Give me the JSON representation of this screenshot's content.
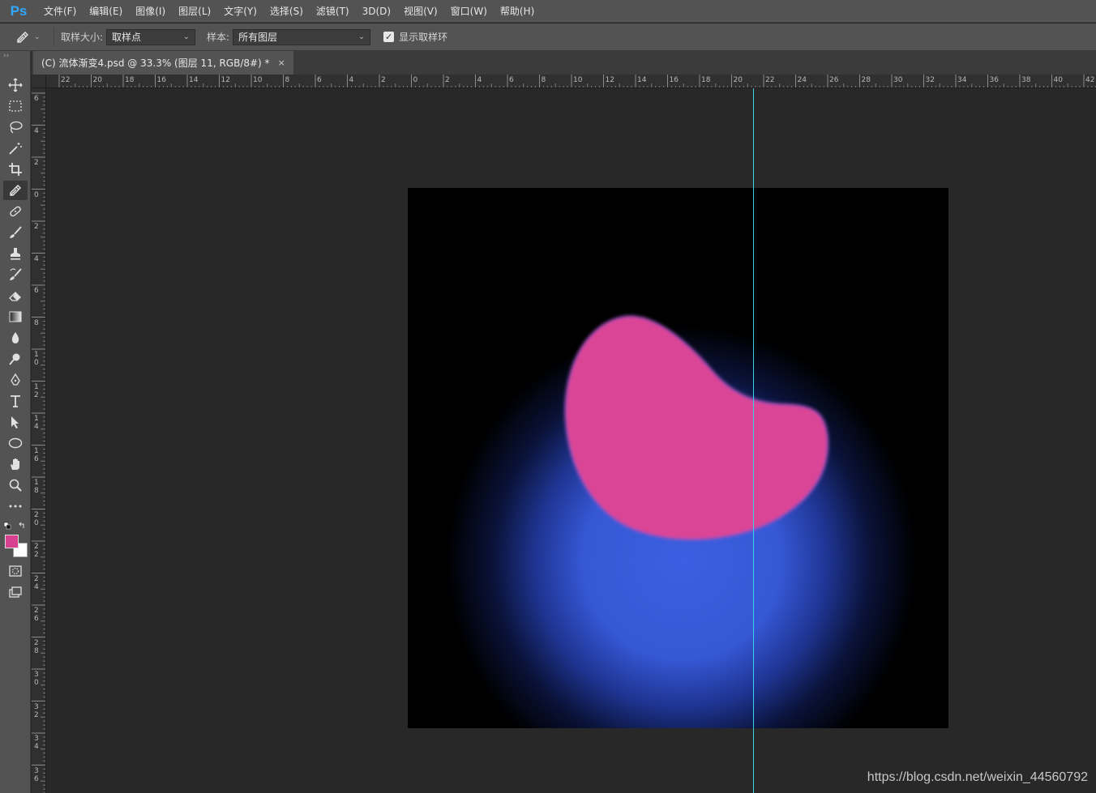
{
  "app": {
    "logo": "Ps"
  },
  "menubar": {
    "items": [
      "文件(F)",
      "编辑(E)",
      "图像(I)",
      "图层(L)",
      "文字(Y)",
      "选择(S)",
      "滤镜(T)",
      "3D(D)",
      "视图(V)",
      "窗口(W)",
      "帮助(H)"
    ]
  },
  "options": {
    "tool_icon": "eyedropper-icon",
    "sample_size_label": "取样大小:",
    "sample_size_value": "取样点",
    "sample_label": "样本:",
    "sample_value": "所有图层",
    "show_ring_label": "显示取样环",
    "show_ring_checked": true
  },
  "tools": [
    {
      "name": "move-tool",
      "icon": "move-icon"
    },
    {
      "name": "marquee-tool",
      "icon": "rect-marquee-icon"
    },
    {
      "name": "lasso-tool",
      "icon": "lasso-icon"
    },
    {
      "name": "magic-wand-tool",
      "icon": "magic-wand-icon"
    },
    {
      "name": "crop-tool",
      "icon": "crop-icon"
    },
    {
      "name": "eyedropper-tool",
      "icon": "eyedropper-icon",
      "active": true
    },
    {
      "name": "healing-brush-tool",
      "icon": "bandage-icon"
    },
    {
      "name": "brush-tool",
      "icon": "brush-icon"
    },
    {
      "name": "stamp-tool",
      "icon": "stamp-icon"
    },
    {
      "name": "history-brush-tool",
      "icon": "history-brush-icon"
    },
    {
      "name": "eraser-tool",
      "icon": "eraser-icon"
    },
    {
      "name": "gradient-tool",
      "icon": "gradient-icon"
    },
    {
      "name": "blur-tool",
      "icon": "drop-icon"
    },
    {
      "name": "dodge-tool",
      "icon": "dodge-icon"
    },
    {
      "name": "pen-tool",
      "icon": "pen-icon"
    },
    {
      "name": "type-tool",
      "icon": "type-icon"
    },
    {
      "name": "path-selection-tool",
      "icon": "arrow-icon"
    },
    {
      "name": "ellipse-tool",
      "icon": "ellipse-icon"
    },
    {
      "name": "hand-tool",
      "icon": "hand-icon"
    },
    {
      "name": "zoom-tool",
      "icon": "zoom-icon"
    },
    {
      "name": "more-tools",
      "icon": "ellipsis-icon"
    }
  ],
  "colors": {
    "foreground": "#d8418f",
    "background": "#ffffff",
    "blob": "#db4595",
    "glow": "#3b5fe0",
    "guide": "#39d2e8"
  },
  "document_tab": {
    "title": "(C) 流体渐变4.psd @ 33.3% (图层 11, RGB/8#) *",
    "close": "×"
  },
  "ruler_h": [
    "22",
    "20",
    "18",
    "16",
    "14",
    "12",
    "10",
    "8",
    "6",
    "4",
    "2",
    "0",
    "2",
    "4",
    "6",
    "8",
    "10",
    "12",
    "14",
    "16",
    "18",
    "20",
    "22",
    "24",
    "26",
    "28",
    "30",
    "32",
    "34",
    "36",
    "38",
    "40",
    "42"
  ],
  "ruler_v": [
    "6",
    "4",
    "2",
    "0",
    "2",
    "4",
    "6",
    "8",
    "10",
    "12",
    "14",
    "16",
    "18",
    "20",
    "22",
    "24",
    "26",
    "28",
    "30",
    "32",
    "34",
    "36"
  ],
  "watermark": "https://blog.csdn.net/weixin_44560792"
}
